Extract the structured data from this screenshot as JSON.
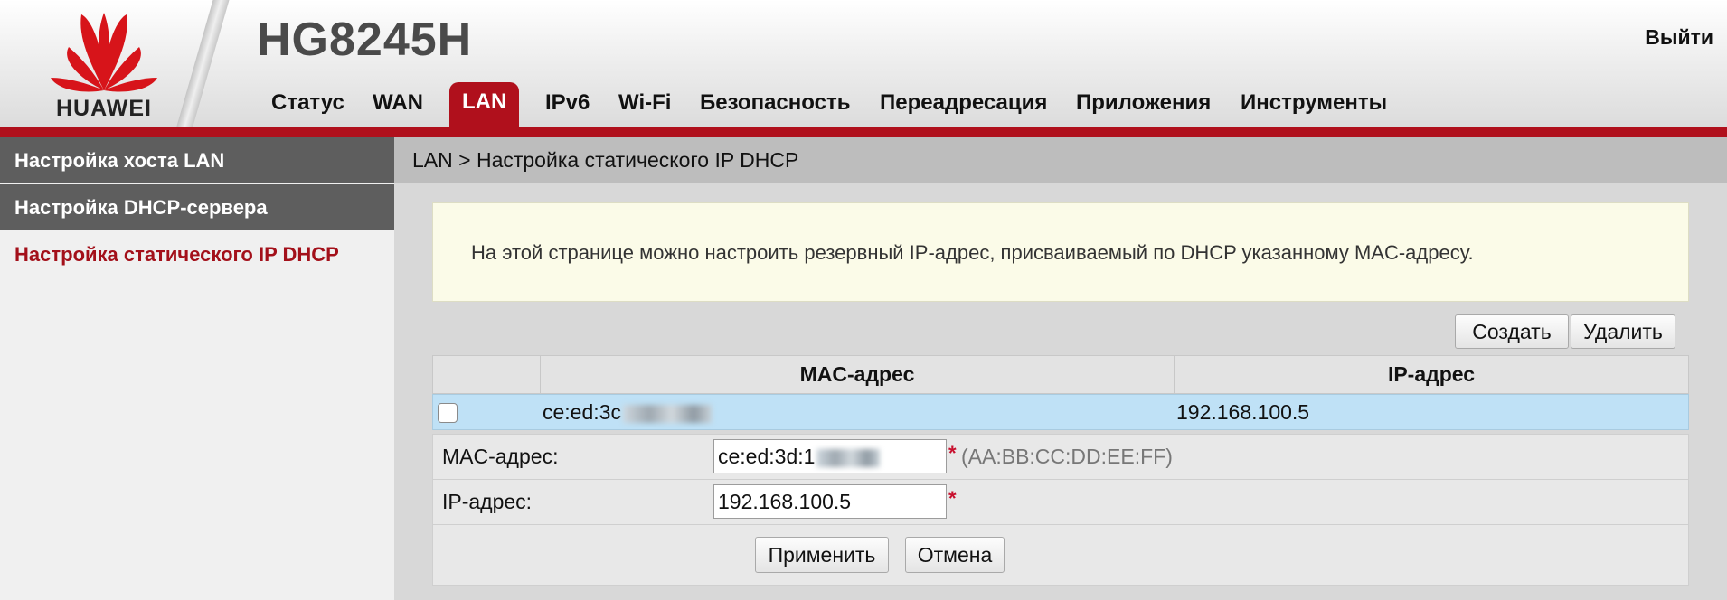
{
  "colors": {
    "accent": "#b0101c",
    "sidebar_dark": "#5e5e5e",
    "row_selected": "#bfe1f6",
    "info_bg": "#fbfbe8"
  },
  "header": {
    "logo_text": "HUAWEI",
    "device_title": "HG8245H",
    "logout_label": "Выйти",
    "tabs": [
      {
        "label": "Статус"
      },
      {
        "label": "WAN"
      },
      {
        "label": "LAN",
        "active": true
      },
      {
        "label": "IPv6"
      },
      {
        "label": "Wi-Fi"
      },
      {
        "label": "Безопасность"
      },
      {
        "label": "Переадресация"
      },
      {
        "label": "Приложения"
      },
      {
        "label": "Инструменты"
      }
    ]
  },
  "sidebar": {
    "items": [
      {
        "label": "Настройка хоста LAN"
      },
      {
        "label": "Настройка DHCP-сервера"
      },
      {
        "label": "Настройка статического IP DHCP",
        "selected": true
      }
    ]
  },
  "main": {
    "breadcrumb": "LAN > Настройка статического IP DHCP",
    "info_text": "На этой странице можно настроить резервный IP-адрес, присваиваемый по DHCP указанному MAC-адресу.",
    "create_label": "Создать",
    "delete_label": "Удалить",
    "table": {
      "headers": [
        "MAC-адрес",
        "IP-адрес"
      ],
      "rows": [
        {
          "mac_visible": "ce:ed:3c",
          "ip": "192.168.100.5",
          "selected": true
        }
      ]
    },
    "form": {
      "mac_label": "MAC-адрес:",
      "mac_value": "ce:ed:3d:1",
      "mac_hint": "(AA:BB:CC:DD:EE:FF)",
      "ip_label": "IP-адрес:",
      "ip_value": "192.168.100.5",
      "required_mark": "*",
      "apply_label": "Применить",
      "cancel_label": "Отмена"
    }
  }
}
